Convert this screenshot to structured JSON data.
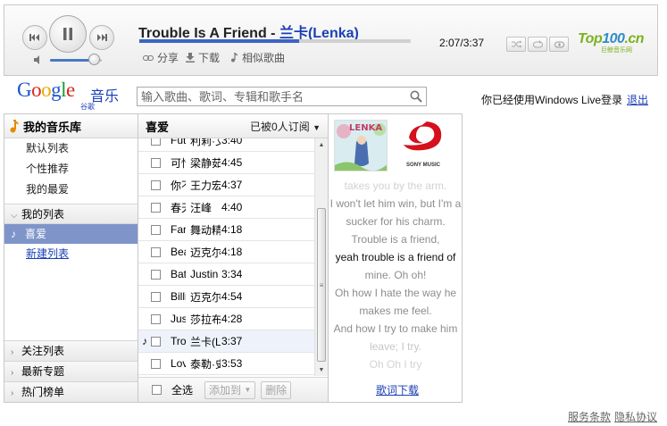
{
  "player": {
    "song_name": "Trouble Is A Friend",
    "separator": " - ",
    "artist": "兰卡(Lenka)",
    "elapsed_time": "2:07/3:37",
    "progress_fraction": 0.59,
    "volume_fraction": 0.85,
    "actions": {
      "share": "分享",
      "download": "下载",
      "similar": "相似歌曲"
    },
    "logo": {
      "top": "Top",
      "num": "100",
      "cn_suffix": ".cn",
      "sub": "巨鲸音乐网"
    },
    "icons": {
      "prev": "previous-icon",
      "play": "pause-icon",
      "next": "next-icon",
      "volume": "speaker-icon",
      "shuffle": "shuffle-icon",
      "repeat": "repeat-icon",
      "repeat_one": "repeat-one-icon"
    }
  },
  "header": {
    "logo_word": [
      "G",
      "o",
      "o",
      "g",
      "l",
      "e"
    ],
    "logo_music": "音乐",
    "logo_cn": "谷歌",
    "search_placeholder": "输入歌曲、歌词、专辑和歌手名",
    "login_text": "你已经使用Windows Live登录",
    "logout": "退出"
  },
  "sidebar": {
    "library_title": "我的音乐库",
    "library_items": [
      "默认列表",
      "个性推荐",
      "我的最爱"
    ],
    "my_lists": "我的列表",
    "favorite_list": "喜爱",
    "new_list": "新建列表",
    "follow_lists": "关注列表",
    "latest_topics": "最新专题",
    "hot_charts": "热门榜单"
  },
  "playlist": {
    "title": "喜爱",
    "subscribers": "已被0人订阅",
    "select_all": "全选",
    "add_to": "添加到",
    "delete": "删除",
    "songs": [
      {
        "name": "Fut",
        "artist": "利莉·艾伦",
        "duration": "3:40",
        "playing": false
      },
      {
        "name": "可惜",
        "artist": "梁静茹",
        "duration": "4:45",
        "playing": false
      },
      {
        "name": "你不",
        "artist": "王力宏",
        "duration": "4:37",
        "playing": false
      },
      {
        "name": "春天",
        "artist": "汪峰",
        "duration": "4:40",
        "playing": false
      },
      {
        "name": "Far",
        "artist": "舞动精灵",
        "duration": "4:18",
        "playing": false
      },
      {
        "name": "Bea",
        "artist": "迈克尔",
        "duration": "4:18",
        "playing": false
      },
      {
        "name": "Bat",
        "artist": "Justin",
        "duration": "3:34",
        "playing": false
      },
      {
        "name": "Billi",
        "artist": "迈克尔",
        "duration": "4:54",
        "playing": false
      },
      {
        "name": "Jus",
        "artist": "莎拉布",
        "duration": "4:28",
        "playing": false
      },
      {
        "name": "Tro",
        "artist": "兰卡(Lenka)",
        "duration": "3:37",
        "playing": true
      },
      {
        "name": "Lov",
        "artist": "泰勒·史",
        "duration": "3:53",
        "playing": false
      }
    ]
  },
  "lyrics": {
    "album_text": "LENKA",
    "label_name": "SONY MUSIC",
    "lines": [
      "takes you by the arm.",
      "I won't let him win, but I'm a",
      "sucker for his charm.",
      "Trouble is a friend,",
      "yeah trouble is a friend of",
      "mine. Oh oh!",
      "Oh how I hate the way he",
      "makes me feel.",
      "And how I try to make him",
      "leave; I try.",
      "Oh Oh I try"
    ],
    "current_line_index": 4,
    "download": "歌词下载"
  },
  "footer": {
    "terms": "服务条款",
    "privacy": "隐私协议"
  },
  "colors": {
    "accent": "#1b3fb5",
    "selected_row": "#7f95c9",
    "progress": "#3c64c0"
  }
}
